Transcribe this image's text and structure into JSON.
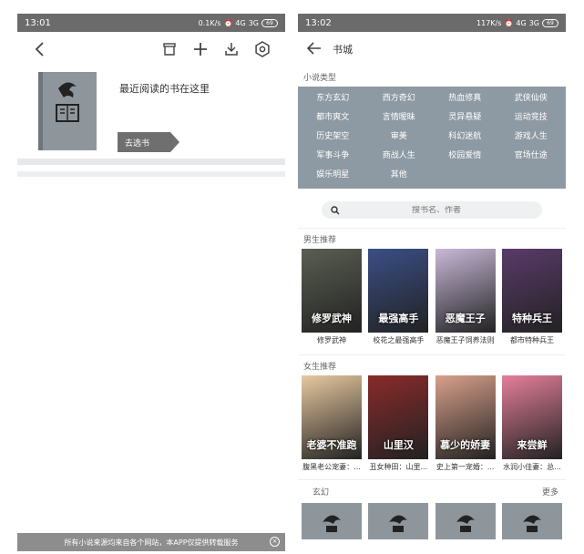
{
  "left": {
    "status": {
      "time": "13:01",
      "network": "0.1K/s",
      "signal": "4G",
      "signal2": "3G",
      "battery": "69"
    },
    "toolbar": {
      "back": "back-icon"
    },
    "shelf": {
      "message": "最近阅读的书在这里",
      "go_label": "去选书"
    },
    "banner": {
      "text": "所有小说来源均来自各个网站，本APP仅提供转载服务",
      "close": "×"
    }
  },
  "right": {
    "status": {
      "time": "13:02",
      "network": "117K/s",
      "signal": "4G",
      "signal2": "3G",
      "battery": "69"
    },
    "nav": {
      "title": "书城"
    },
    "genres_label": "小说类型",
    "genres": [
      "东方玄幻",
      "西方奇幻",
      "热血修真",
      "武侠仙侠",
      "都市爽文",
      "言情暧昧",
      "灵异悬疑",
      "运动竞技",
      "历史架空",
      "审美",
      "科幻迷航",
      "游戏人生",
      "军事斗争",
      "商战人生",
      "校园爱情",
      "官场仕途",
      "娱乐明星",
      "其他"
    ],
    "search": {
      "placeholder": "搜书名、作者"
    },
    "male": {
      "label": "男生推荐",
      "books": [
        {
          "name": "修罗武神",
          "cover_text": "修罗武神",
          "color": "#5a5e52"
        },
        {
          "name": "校花之最强高手",
          "cover_text": "最强高手",
          "color": "#3b4f86"
        },
        {
          "name": "恶魔王子饲养法则",
          "cover_text": "恶魔王子",
          "color": "#c9b9d8"
        },
        {
          "name": "都市特种兵王",
          "cover_text": "特种兵王",
          "color": "#5a3b6a"
        }
      ]
    },
    "female": {
      "label": "女生推荐",
      "books": [
        {
          "name": "腹黑老公宠妻：...",
          "cover_text": "老婆不准跑",
          "color": "#e8c9a0"
        },
        {
          "name": "丑女种田：山里...",
          "cover_text": "山里汉",
          "color": "#8a2a2a"
        },
        {
          "name": "史上第一宠婚：...",
          "cover_text": "慕少的娇妻",
          "color": "#d9a08a"
        },
        {
          "name": "水润小佳妻：总...",
          "cover_text": "来尝鲜",
          "color": "#e47f9a"
        }
      ]
    },
    "xuanhuan": {
      "label": "玄幻",
      "more": "更多"
    }
  }
}
